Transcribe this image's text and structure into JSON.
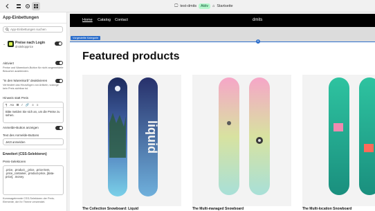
{
  "topbar": {
    "store_name": "test-dmits",
    "store_status": "Aktiv",
    "page_name": "Startseite"
  },
  "sidebar": {
    "title": "App-Einbettungen",
    "search_placeholder": "App-Einbettungen suchen",
    "app": {
      "name": "Preise nach Login",
      "developer": "dmitshopprice",
      "enabled": true
    },
    "aktiviert_label": "Aktiviert",
    "aktiviert_help": "Preise und Warenkorb-Button für nicht angemeldete Besucher ausblenden.",
    "hide_cart_label": "\"In den Warenkorb\" deaktivieren",
    "hide_cart_help": "Verhindert das Hinzufügen von Artikeln, solange kein Preis sichtbar ist.",
    "price_hint_label": "Hinweis statt Preis",
    "rte_toolbar": [
      "Aa",
      "B",
      "I",
      "🔗",
      "≡",
      "≡"
    ],
    "price_hint_text": "Bitte melden Sie sich an, um die Preise zu sehen.",
    "login_button_label": "Anmelde-Button anzeigen",
    "login_button_text_label": "Text des Anmelde-Buttons",
    "login_button_text": "Jetzt anmelden",
    "advanced_title": "Erweitert (CSS-Selektoren)",
    "price_selectors_label": "Preis-Selektoren",
    "price_selectors": ".price, .product__price, .price-item, .price_container, .product-price, [data-price], .money",
    "price_selectors_help": "Kommagetrennte CSS-Selektoren der Preis-Elemente, die Ihr Theme verwendet."
  },
  "preview": {
    "nav": [
      "Home",
      "Catalog",
      "Contact"
    ],
    "brand": "dmits",
    "section_label": "Vorgestellte Kategorie",
    "heading": "Featured products",
    "products": [
      "The Collection Snowboard: Liquid",
      "The Multi-managed Snowboard",
      "The Multi-location Snowboard"
    ]
  }
}
